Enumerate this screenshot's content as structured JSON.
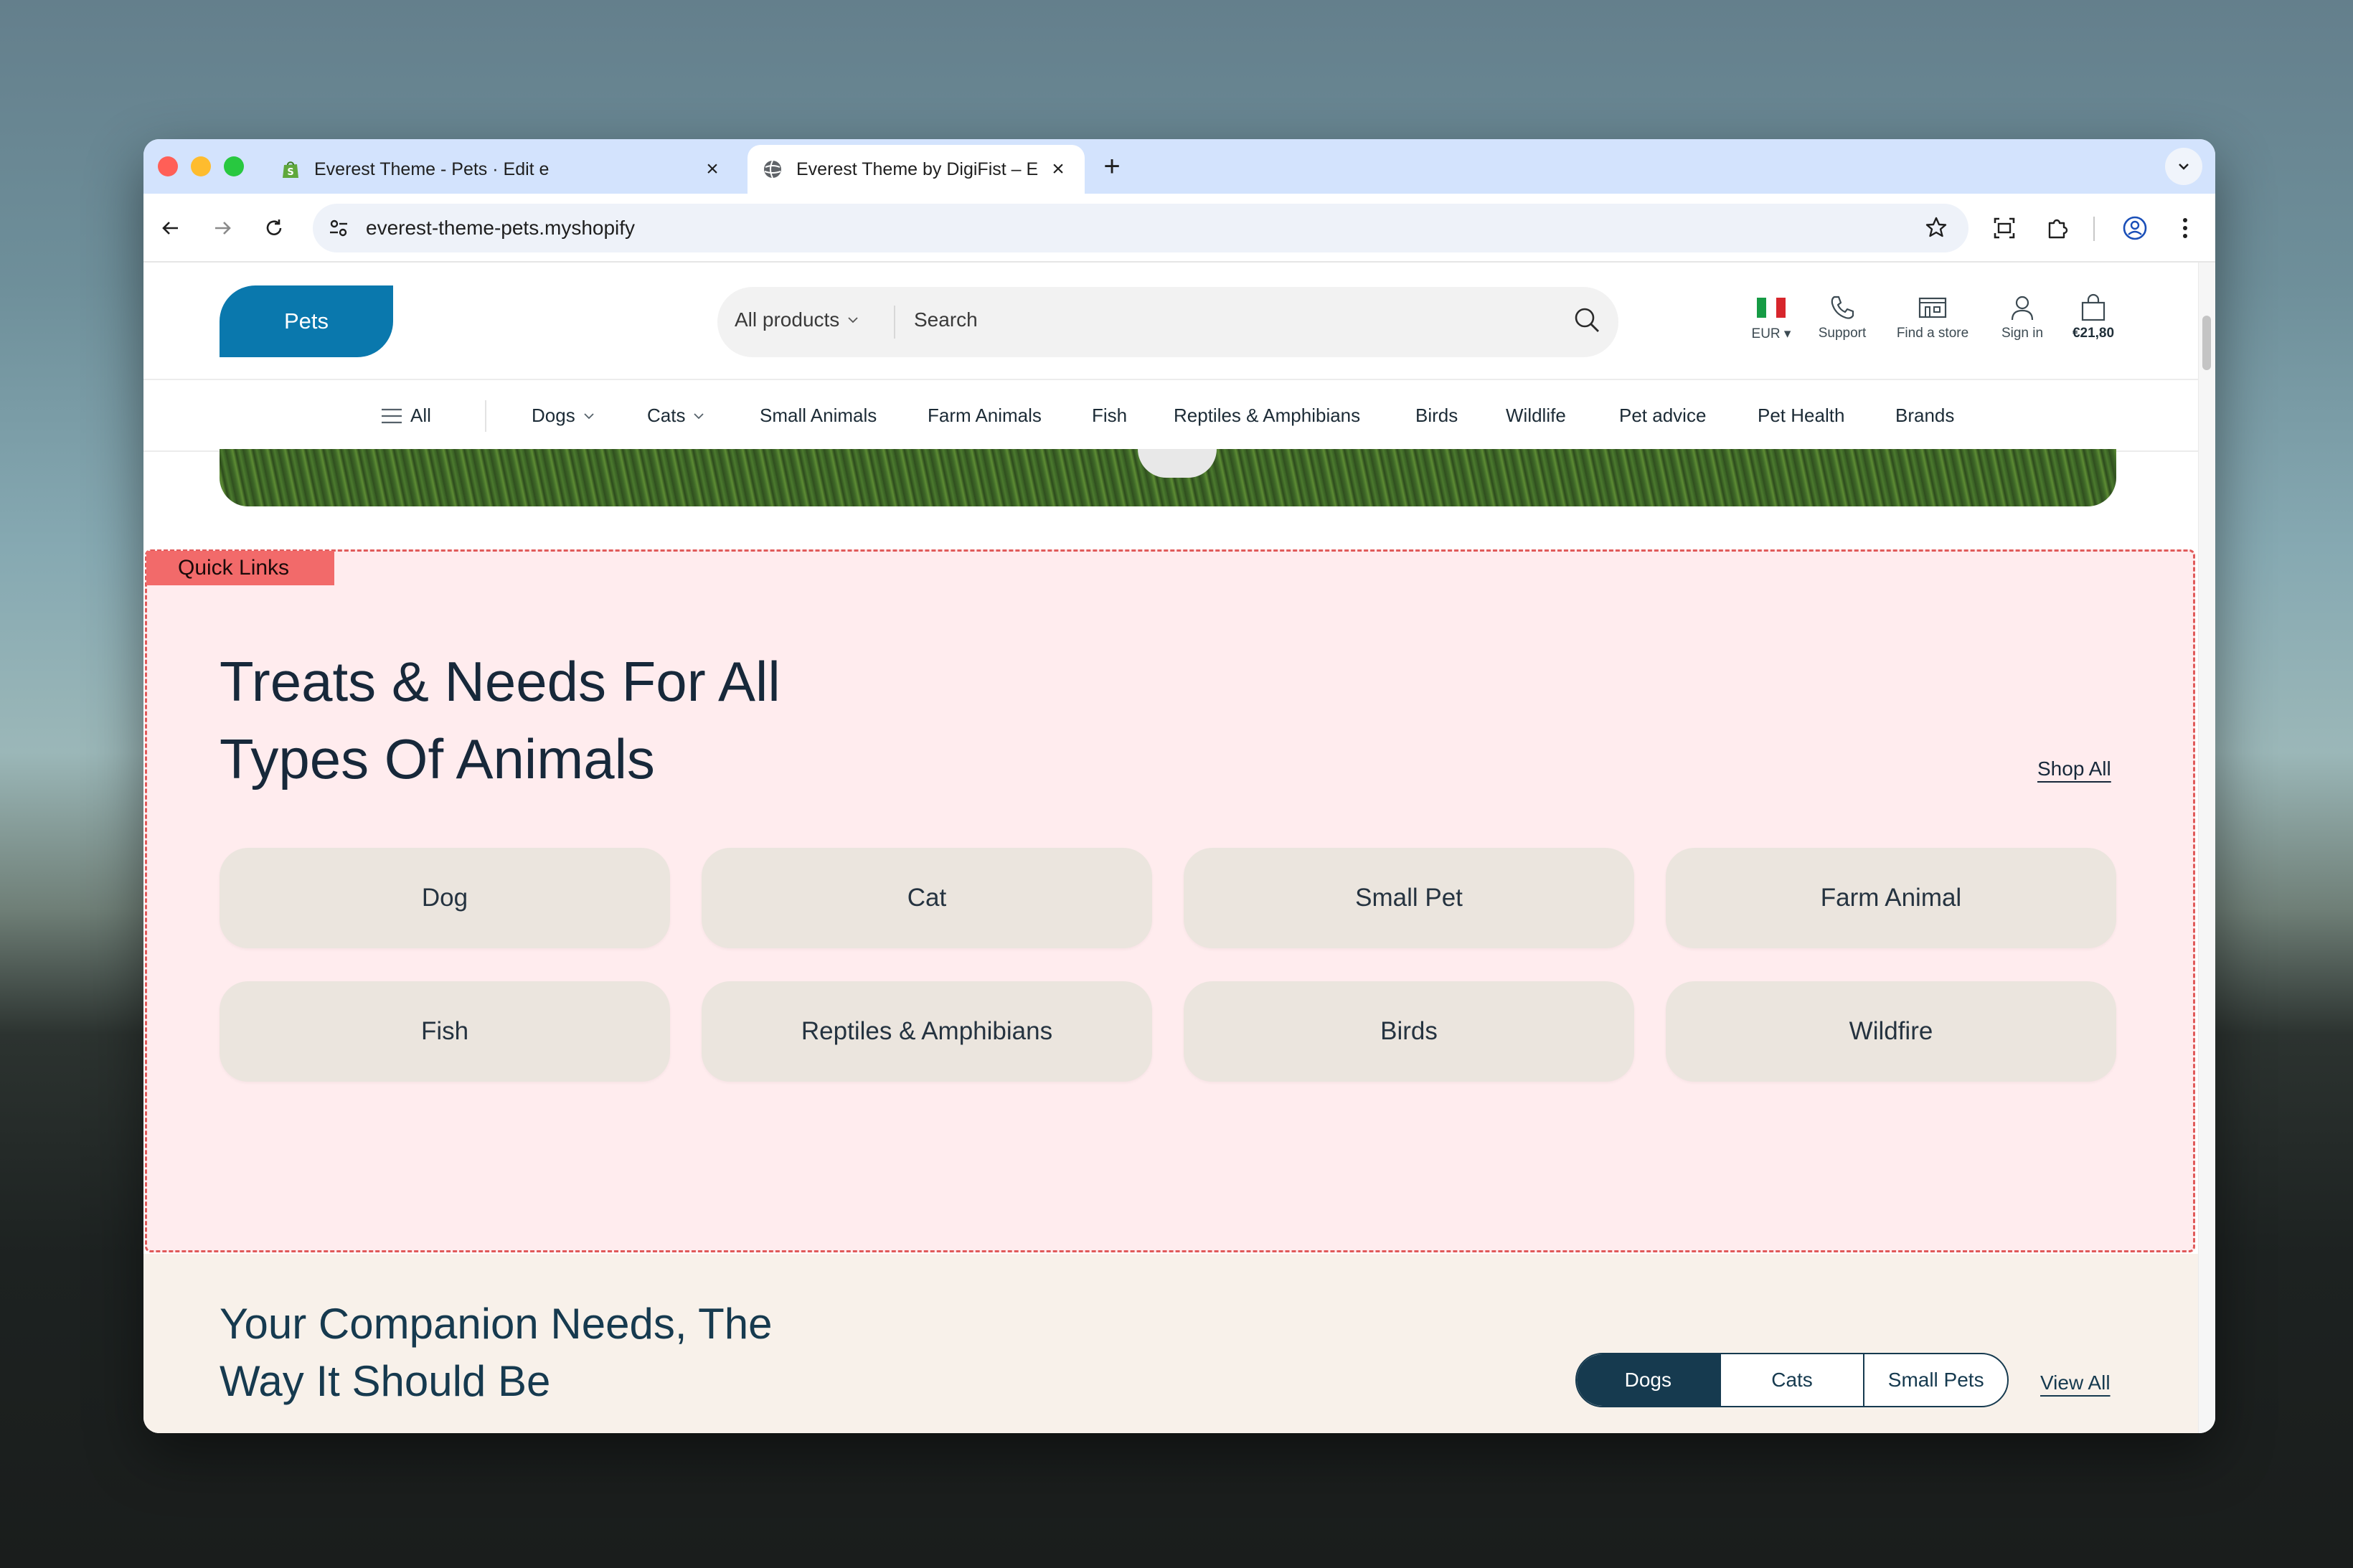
{
  "browser": {
    "tabs": [
      {
        "title": "Everest Theme - Pets · Edit e",
        "active": false
      },
      {
        "title": "Everest Theme by DigiFist – E",
        "active": true
      }
    ],
    "url": "everest-theme-pets.myshopify"
  },
  "header": {
    "logo_text": "Pets",
    "search_category": "All products",
    "search_placeholder": "Search",
    "currency": "EUR",
    "support": "Support",
    "find_store": "Find a store",
    "sign_in": "Sign in",
    "cart_total": "€21,80"
  },
  "nav": {
    "all": "All",
    "items": [
      "Dogs",
      "Cats",
      "Small Animals",
      "Farm Animals",
      "Fish",
      "Reptiles & Amphibians",
      "Birds",
      "Wildlife",
      "Pet advice",
      "Pet Health",
      "Brands"
    ]
  },
  "quick_links": {
    "tag": "Quick Links",
    "title_line1": "Treats & Needs For All",
    "title_line2": "Types Of Animals",
    "shop_all": "Shop All",
    "items": [
      "Dog",
      "Cat",
      "Small Pet",
      "Farm Animal",
      "Fish",
      "Reptiles & Amphibians",
      "Birds",
      "Wildfire"
    ]
  },
  "companion": {
    "title_line1": "Your Companion Needs, The",
    "title_line2": "Way It Should Be",
    "tabs": [
      "Dogs",
      "Cats",
      "Small Pets"
    ],
    "selected_tab": "Dogs",
    "view_all": "View All"
  }
}
